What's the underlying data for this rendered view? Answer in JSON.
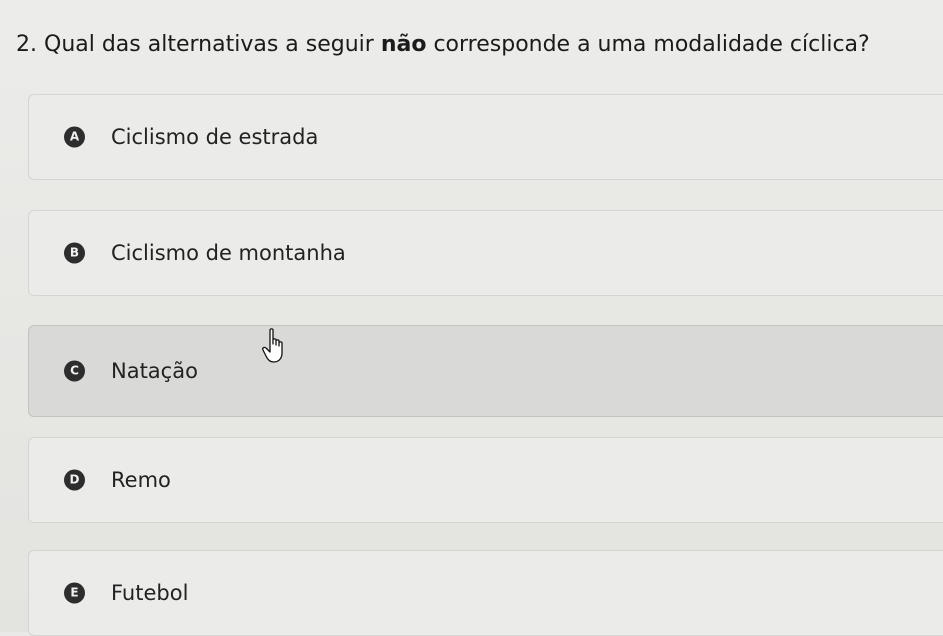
{
  "question": {
    "number": "2.",
    "text_before": "Qual das alternativas a seguir",
    "emphasis": "não",
    "text_after": "corresponde a uma modalidade cíclica?"
  },
  "options": [
    {
      "letter": "A",
      "label": "Ciclismo de estrada"
    },
    {
      "letter": "B",
      "label": "Ciclismo de montanha"
    },
    {
      "letter": "C",
      "label": "Natação"
    },
    {
      "letter": "D",
      "label": "Remo"
    },
    {
      "letter": "E",
      "label": "Futebol"
    }
  ],
  "hovered_option": "C",
  "cursor_icon": "hand-pointer-icon",
  "colors": {
    "background": "#e9e9e7",
    "option_hover": "#d9d9d7",
    "badge": "#2d2d2d"
  }
}
